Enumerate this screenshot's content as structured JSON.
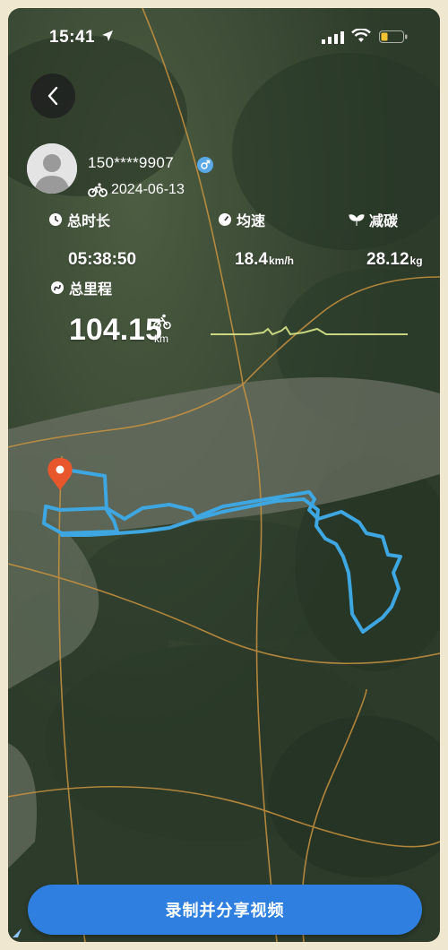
{
  "status_bar": {
    "time": "15:41"
  },
  "profile": {
    "user_id": "150****9907",
    "date": "2024-06-13"
  },
  "stats": {
    "duration": {
      "label": "总时长",
      "value": "05:38:50"
    },
    "avg_speed": {
      "label": "均速",
      "value": "18.4",
      "unit": "km/h"
    },
    "carbon": {
      "label": "减碳",
      "value": "28.12",
      "unit": "kg"
    },
    "distance": {
      "label": "总里程",
      "value": "104.15",
      "unit": "km"
    }
  },
  "cta": {
    "label": "录制并分享视频"
  },
  "colors": {
    "route": "#3ea6e0",
    "start_pin": "#e8572c",
    "cta_background": "#2e7fe0",
    "elevation_line": "#d7e58a"
  }
}
